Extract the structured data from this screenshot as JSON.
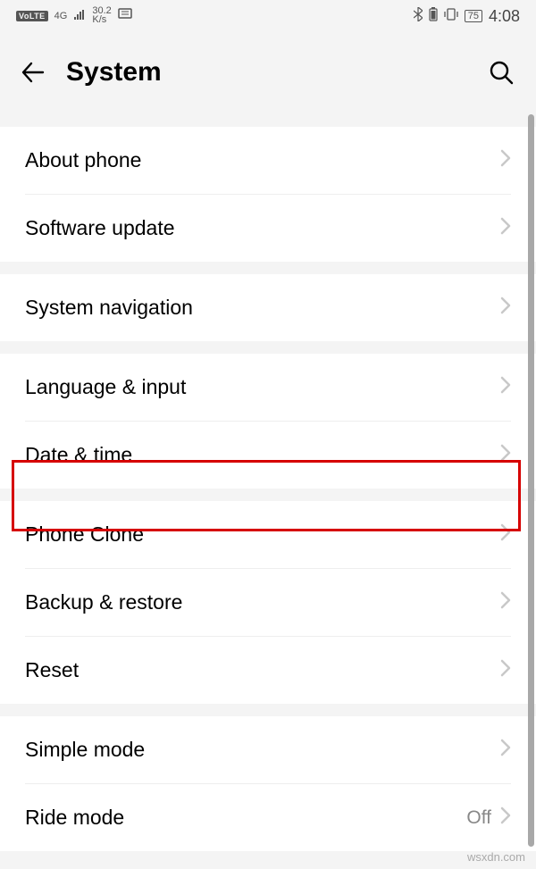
{
  "status": {
    "volte": "VoLTE",
    "net_gen": "4G",
    "kbs_top": "30.2",
    "kbs_bot": "K/s",
    "battery_pct": "75",
    "time": "4:08"
  },
  "header": {
    "title": "System"
  },
  "rows": {
    "about_phone": "About phone",
    "software_update": "Software update",
    "system_navigation": "System navigation",
    "language_input": "Language & input",
    "date_time": "Date & time",
    "phone_clone": "Phone Clone",
    "backup_restore": "Backup & restore",
    "reset": "Reset",
    "simple_mode": "Simple mode",
    "ride_mode": "Ride mode",
    "ride_mode_value": "Off"
  },
  "watermark": "wsxdn.com"
}
